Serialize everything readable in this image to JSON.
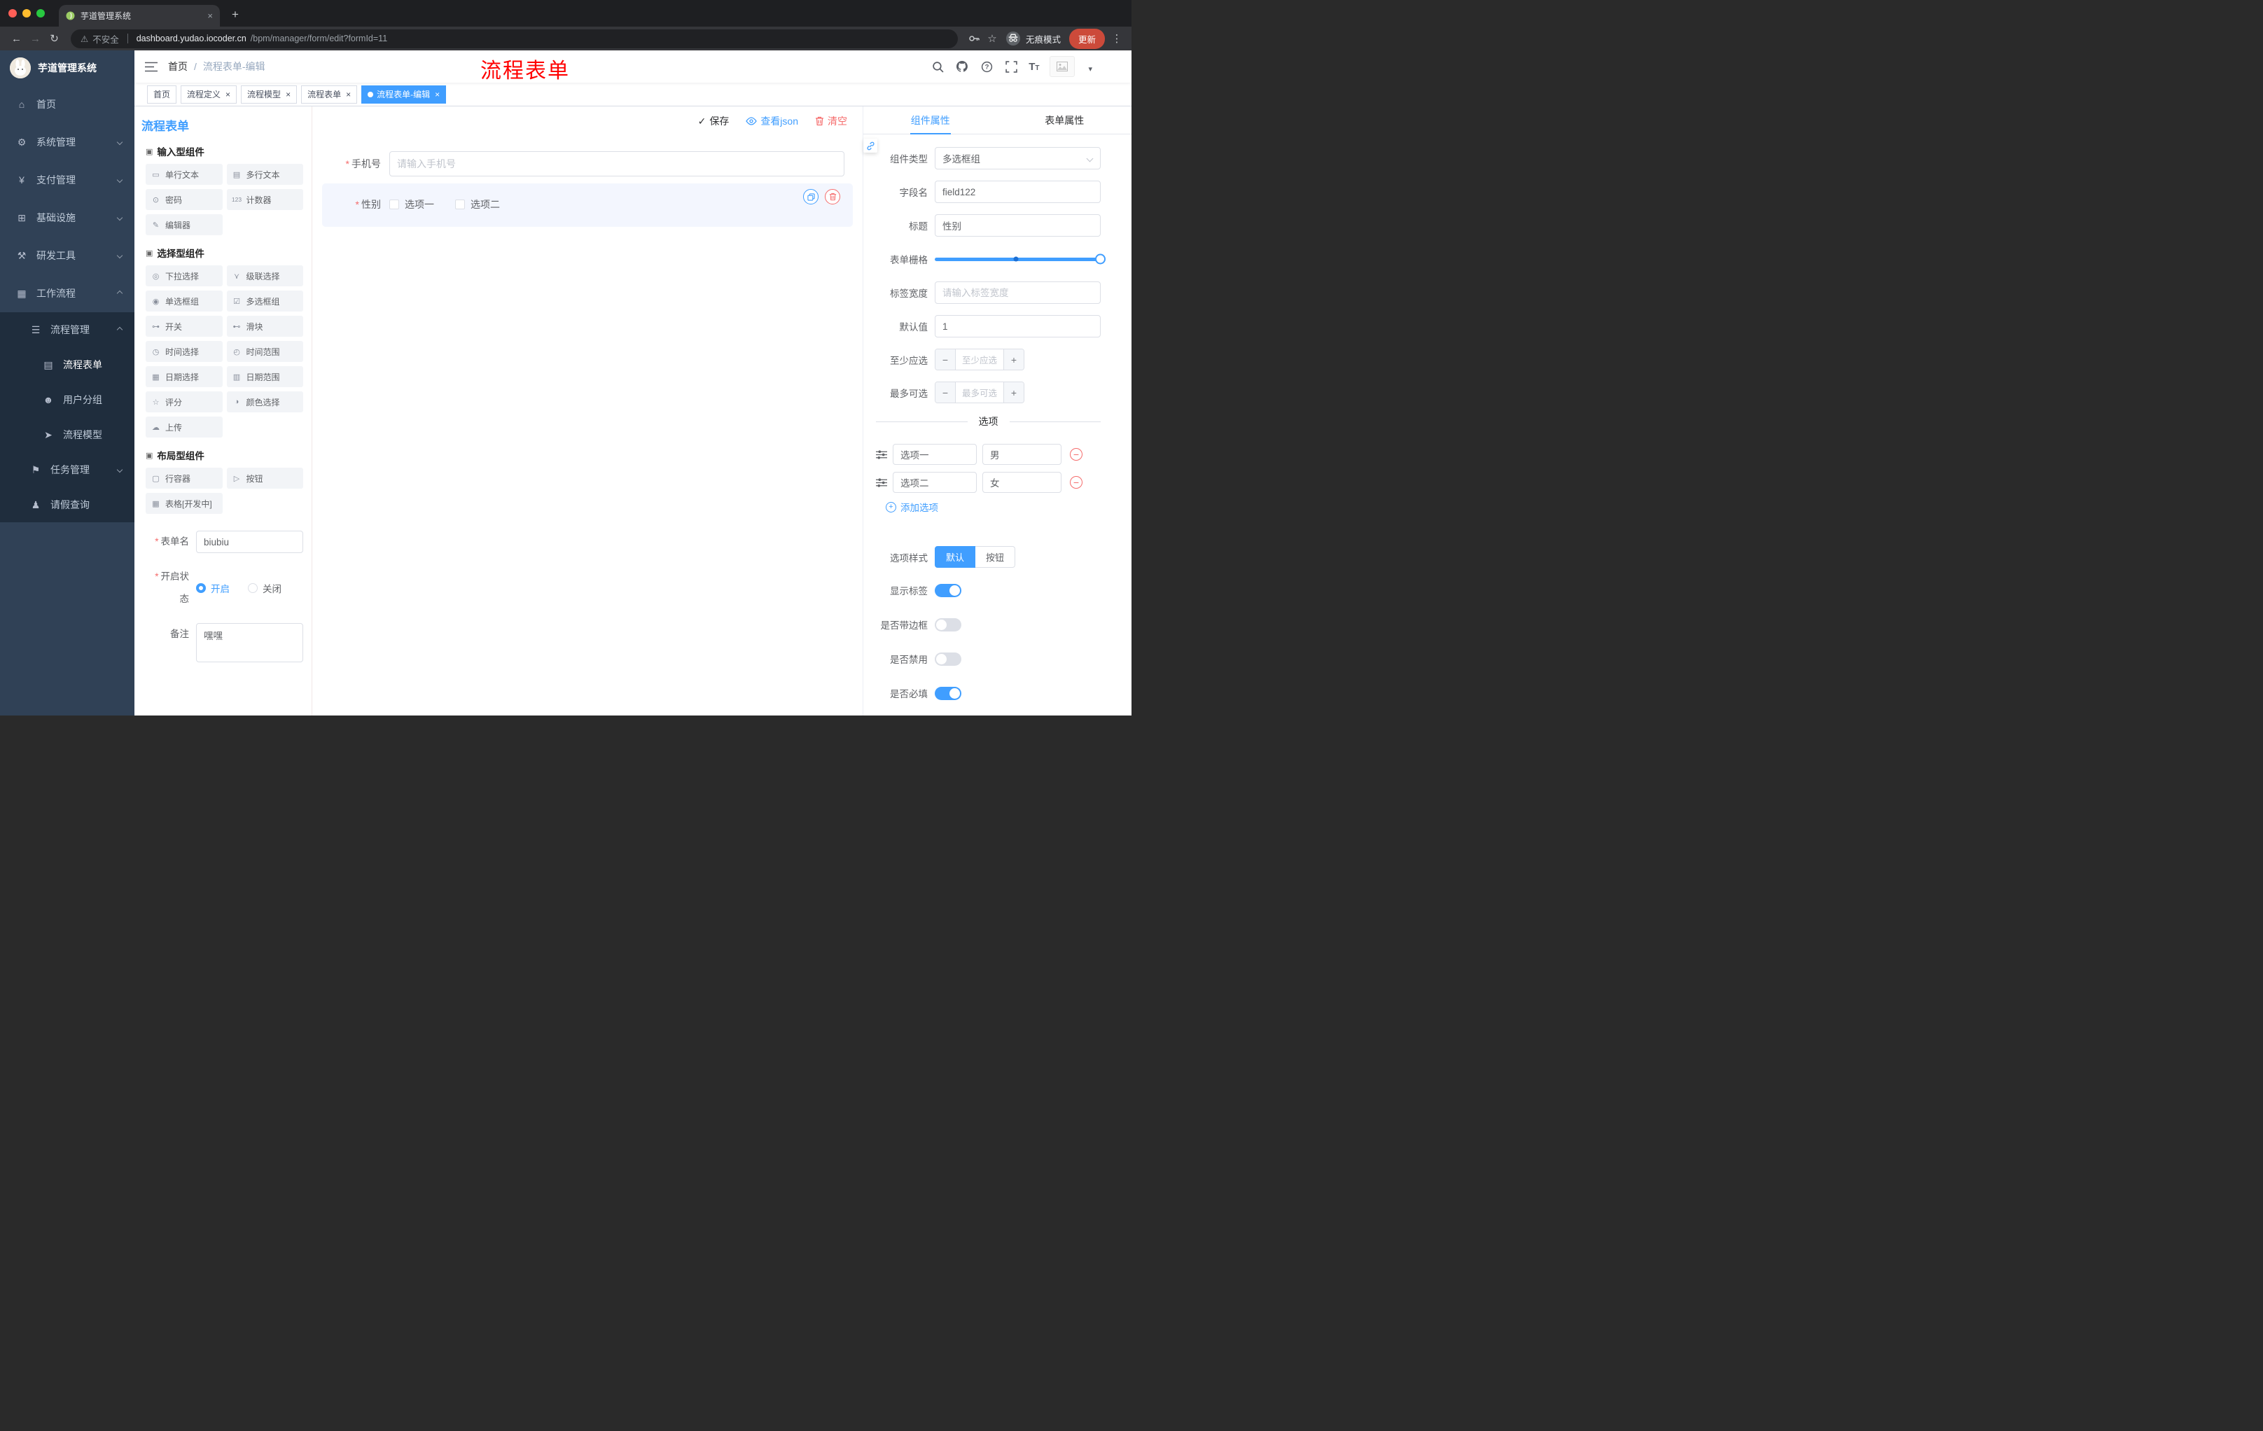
{
  "colors": {
    "accent": "#409eff",
    "danger": "#f56c6c",
    "annotation": "#ff0000"
  },
  "browser": {
    "tab_title": "芋道管理系统",
    "security": "不安全",
    "domain": "dashboard.yudao.iocoder.cn",
    "path": "/bpm/manager/form/edit?formId=11",
    "incognito_label": "无痕模式",
    "update_label": "更新"
  },
  "sidebar": {
    "app_title": "芋道管理系统",
    "items": [
      {
        "label": "首页"
      },
      {
        "label": "系统管理"
      },
      {
        "label": "支付管理"
      },
      {
        "label": "基础设施"
      },
      {
        "label": "研发工具"
      },
      {
        "label": "工作流程"
      }
    ],
    "submenu": [
      {
        "label": "流程管理"
      },
      {
        "label": "流程表单",
        "active": true
      },
      {
        "label": "用户分组"
      },
      {
        "label": "流程模型"
      },
      {
        "label": "任务管理"
      },
      {
        "label": "请假查询"
      }
    ]
  },
  "header": {
    "breadcrumb": {
      "home": "首页",
      "sep": "/",
      "current": "流程表单-编辑"
    },
    "annotation": "流程表单"
  },
  "tags": [
    {
      "label": "首页"
    },
    {
      "label": "流程定义"
    },
    {
      "label": "流程模型"
    },
    {
      "label": "流程表单"
    },
    {
      "label": "流程表单-编辑",
      "active": true
    }
  ],
  "palette": {
    "title": "流程表单",
    "sections": [
      {
        "title": "输入型组件",
        "items": [
          {
            "label": "单行文本",
            "icon": "input-icon",
            "glyph": "▭"
          },
          {
            "label": "多行文本",
            "icon": "textarea-icon",
            "glyph": "▤"
          },
          {
            "label": "密码",
            "icon": "password-lock-icon",
            "glyph": "⊙"
          },
          {
            "label": "计数器",
            "icon": "counter-icon",
            "glyph": "123"
          },
          {
            "label": "编辑器",
            "icon": "editor-icon",
            "glyph": "✎"
          }
        ]
      },
      {
        "title": "选择型组件",
        "items": [
          {
            "label": "下拉选择",
            "icon": "select-icon",
            "glyph": "◎"
          },
          {
            "label": "级联选择",
            "icon": "cascader-icon",
            "glyph": "⋎"
          },
          {
            "label": "单选框组",
            "icon": "radio-group-icon",
            "glyph": "◉"
          },
          {
            "label": "多选框组",
            "icon": "checkbox-group-icon",
            "glyph": "☑"
          },
          {
            "label": "开关",
            "icon": "switch-icon",
            "glyph": "⊶"
          },
          {
            "label": "滑块",
            "icon": "slider-icon",
            "glyph": "⊷"
          },
          {
            "label": "时间选择",
            "icon": "time-icon",
            "glyph": "◷"
          },
          {
            "label": "时间范围",
            "icon": "time-range-icon",
            "glyph": "◴"
          },
          {
            "label": "日期选择",
            "icon": "date-icon",
            "glyph": "▦"
          },
          {
            "label": "日期范围",
            "icon": "date-range-icon",
            "glyph": "▥"
          },
          {
            "label": "评分",
            "icon": "rate-star-icon",
            "glyph": "☆"
          },
          {
            "label": "颜色选择",
            "icon": "color-picker-icon",
            "glyph": "◑"
          },
          {
            "label": "上传",
            "icon": "upload-cloud-icon",
            "glyph": "☁"
          }
        ]
      },
      {
        "title": "布局型组件",
        "items": [
          {
            "label": "行容器",
            "icon": "row-container-icon",
            "glyph": "▢"
          },
          {
            "label": "按钮",
            "icon": "button-icon",
            "glyph": "▷"
          },
          {
            "label": "表格[开发中]",
            "icon": "table-icon",
            "glyph": "▦"
          }
        ]
      }
    ],
    "form": {
      "name_label": "表单名",
      "name_value": "biubiu",
      "status_label": "开启状态",
      "status_on": "开启",
      "status_on_checked": true,
      "status_off": "关闭",
      "remark_label": "备注",
      "remark_value": "嘿嘿"
    }
  },
  "canvas": {
    "actions": {
      "save": "保存",
      "view_json": "查看json",
      "clear": "清空"
    },
    "phone": {
      "label": "手机号",
      "placeholder": "请输入手机号"
    },
    "gender": {
      "label": "性别",
      "option1": "选项一",
      "option2": "选项二"
    }
  },
  "props": {
    "tabs": {
      "component": "组件属性",
      "component_active": true,
      "form": "表单属性"
    },
    "rows": {
      "type_label": "组件类型",
      "type_value": "多选框组",
      "field_label": "字段名",
      "field_value": "field122",
      "title_label": "标题",
      "title_value": "性别",
      "grid_label": "表单栅格",
      "labelwidth_label": "标签宽度",
      "labelwidth_placeholder": "请输入标签宽度",
      "default_label": "默认值",
      "default_value": "1",
      "min_label": "至少应选",
      "min_placeholder": "至少应选",
      "max_label": "最多可选",
      "max_placeholder": "最多可选"
    },
    "options": {
      "divider": "选项",
      "rows": [
        {
          "label": "选项一",
          "value": "男"
        },
        {
          "label": "选项二",
          "value": "女"
        }
      ],
      "add": "添加选项"
    },
    "style": {
      "label": "选项样式",
      "default": "默认",
      "default_active": true,
      "button": "按钮"
    },
    "switches": [
      {
        "label": "显示标签",
        "on": true
      },
      {
        "label": "是否带边框",
        "on": false
      },
      {
        "label": "是否禁用",
        "on": false
      },
      {
        "label": "是否必填",
        "on": true
      }
    ]
  }
}
